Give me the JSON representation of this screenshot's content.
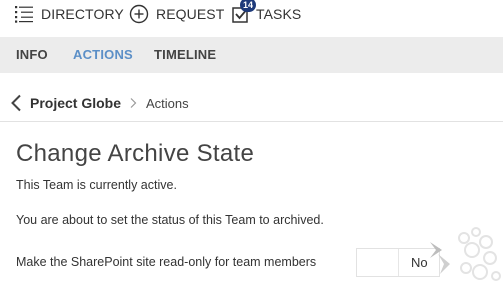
{
  "topnav": {
    "directory_label": "DIRECTORY",
    "request_label": "REQUEST",
    "tasks_label": "TASKS",
    "tasks_badge": "14"
  },
  "tabs": [
    {
      "label": "INFO",
      "active": false
    },
    {
      "label": "ACTIONS",
      "active": true
    },
    {
      "label": "TIMELINE",
      "active": false
    }
  ],
  "breadcrumb": {
    "project": "Project Globe",
    "current": "Actions"
  },
  "page": {
    "title": "Change Archive State",
    "status_text": "This Team is currently active.",
    "info_text": "You are about to set the status of this Team to archived.",
    "readonly_label": "Make the SharePoint site read-only for team members",
    "readonly_toggle_state": "No"
  },
  "colors": {
    "accent": "#5b8fc7",
    "badge": "#1e3a7a",
    "tabbar_bg": "#ececec"
  },
  "icons": {
    "directory": "list-icon",
    "request": "plus-circle-icon",
    "tasks": "checkbox-icon",
    "back": "chevron-left-icon",
    "separator": "chevron-right-icon"
  }
}
